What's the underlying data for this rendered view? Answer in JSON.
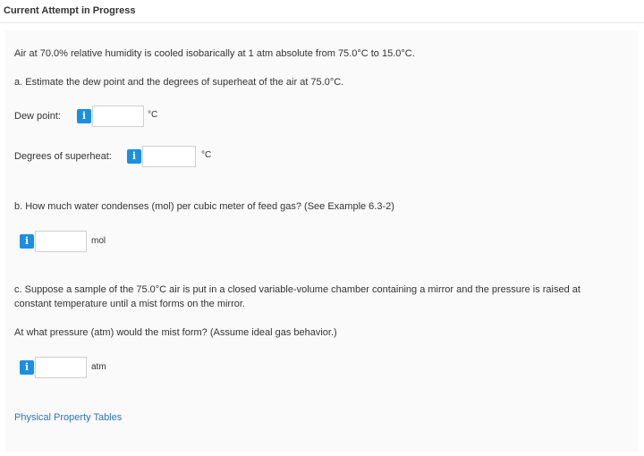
{
  "header": {
    "title": "Current Attempt in Progress"
  },
  "problem": {
    "intro": "Air at 70.0% relative humidity is cooled isobarically at 1 atm absolute from 75.0°C to 15.0°C.",
    "part_a": {
      "question": "a. Estimate the dew point and the degrees of superheat of the air at 75.0°C.",
      "dew_point": {
        "label": "Dew point:",
        "value": "",
        "unit": "°C"
      },
      "superheat": {
        "label": "Degrees of superheat:",
        "value": "",
        "unit": "°C"
      }
    },
    "part_b": {
      "question": "b. How much water condenses (mol) per cubic meter of feed gas? (See Example 6.3-2)",
      "answer": {
        "value": "",
        "unit": "mol"
      }
    },
    "part_c": {
      "question_line1": "c. Suppose a sample of the 75.0°C air is put in a closed variable-volume chamber containing a mirror and the pressure is raised at",
      "question_line2": "constant temperature until a mist forms on the mirror.",
      "followup": "At what pressure (atm) would the mist form? (Assume ideal gas behavior.)",
      "answer": {
        "value": "",
        "unit": "atm"
      }
    },
    "link": "Physical Property Tables"
  },
  "icons": {
    "info": "i"
  },
  "colors": {
    "info_button": "#1a8fe3",
    "link": "#2b74b8",
    "panel": "#fafafa"
  }
}
